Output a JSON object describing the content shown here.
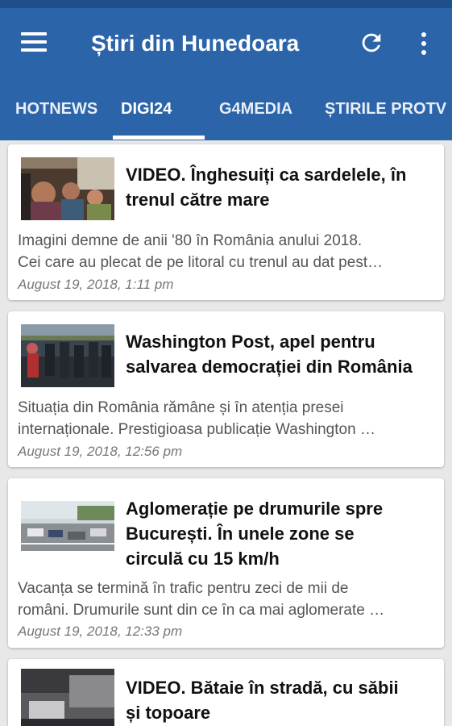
{
  "app": {
    "title": "Știri din Hunedoara"
  },
  "tabs": [
    {
      "label": "HOTNEWS",
      "active": false
    },
    {
      "label": "DIGI24",
      "active": true
    },
    {
      "label": "G4MEDIA",
      "active": false
    },
    {
      "label": "ȘTIRILE PROTV",
      "active": false
    }
  ],
  "articles": [
    {
      "headline_1": "VIDEO. Înghesuiți ca sardelele, în",
      "headline_2": "trenul către mare",
      "headline_3": "",
      "summary_1": "Imagini demne de anii '80 în România anului 2018.",
      "summary_2": "Cei care au plecat de pe litoral cu trenul au dat pest…",
      "date": "August 19, 2018, 1:11 pm",
      "thumb_icon": "crowded-train-photo"
    },
    {
      "headline_1": "Washington Post, apel pentru",
      "headline_2": "salvarea democrației din România",
      "headline_3": "",
      "summary_1": "Situația din România rămâne și în atenția presei",
      "summary_2": "internaționale. Prestigioasa publicație Washington …",
      "date": "August 19, 2018, 12:56 pm",
      "thumb_icon": "protest-police-photo"
    },
    {
      "headline_1": "Aglomerație pe drumurile spre",
      "headline_2": "București. În unele zone se",
      "headline_3": "circulă cu 15 km/h",
      "summary_1": "Vacanța se termină în trafic pentru zeci de mii de",
      "summary_2": "români. Drumurile sunt din ce în ca mai aglomerate …",
      "date": "August 19, 2018, 12:33 pm",
      "thumb_icon": "highway-traffic-photo"
    },
    {
      "headline_1": "VIDEO. Bătaie în stradă, cu săbii",
      "headline_2": "și topoare",
      "headline_3": "",
      "summary_1": "",
      "summary_2": "",
      "date": "",
      "thumb_icon": "street-scene-photo"
    }
  ],
  "colors": {
    "primary": "#2b64a8",
    "statusbar": "#1f4f8a",
    "background": "#e8e8e8"
  }
}
